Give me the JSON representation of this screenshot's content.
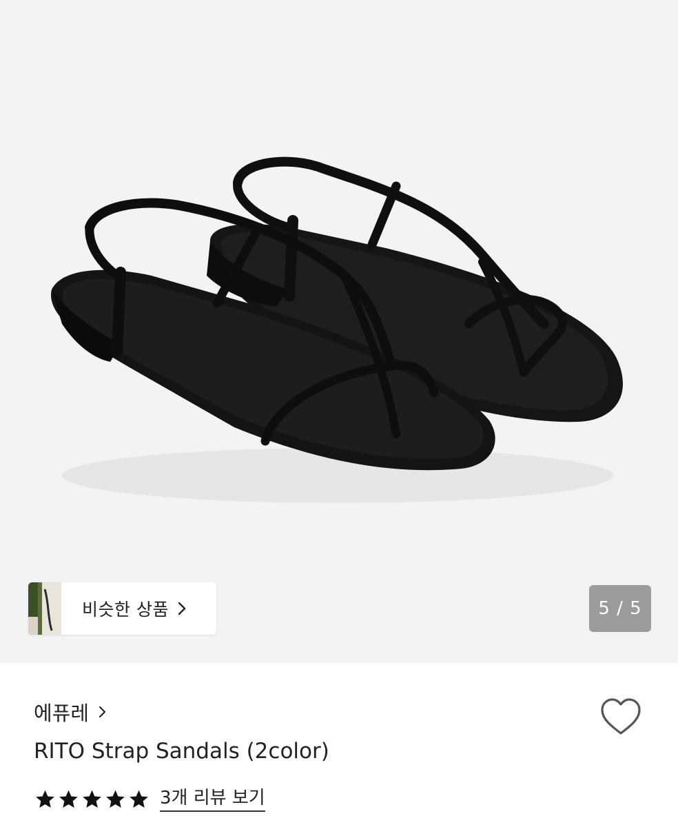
{
  "gallery": {
    "similar_label": "비슷한 상품",
    "counter": "5 / 5"
  },
  "product": {
    "brand": "에퓨레",
    "title": "RITO Strap Sandals (2color)",
    "rating": 5,
    "review_link": "3개 리뷰 보기"
  },
  "icons": {
    "brand_chevron": "chevron-right-icon",
    "similar_chevron": "chevron-right-icon",
    "wishlist": "heart-outline-icon",
    "star": "star-filled-icon"
  },
  "colors": {
    "gallery_bg": "#f3f3f3",
    "counter_bg": "#9b9b9b",
    "text": "#222222",
    "sandal": "#111111"
  }
}
